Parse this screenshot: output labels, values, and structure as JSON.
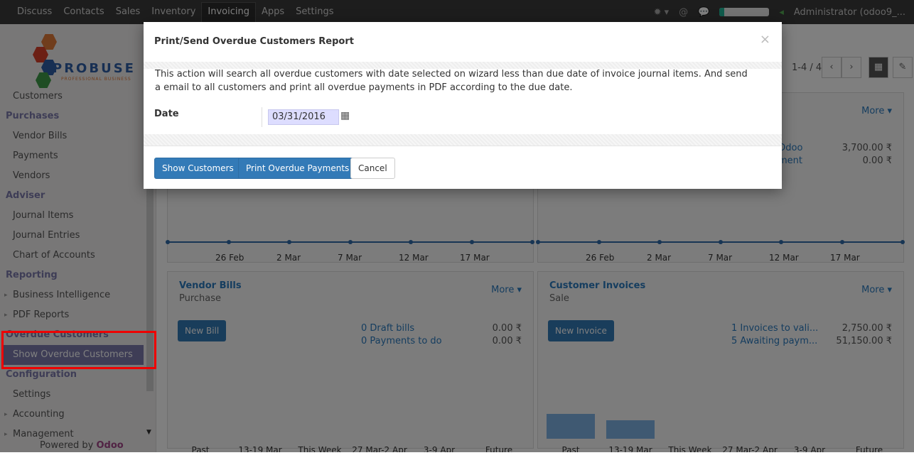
{
  "topbar": {
    "menu": [
      "Discuss",
      "Contacts",
      "Sales",
      "Inventory",
      "Invoicing",
      "Apps",
      "Settings"
    ],
    "active": "Invoicing",
    "user": "Administrator (odoo9_...",
    "progress": 0.1
  },
  "sidebar": {
    "logo_text": "PROBUSE",
    "logo_tag": "PROFESSIONAL BUSINESS",
    "items": [
      {
        "type": "link",
        "label": "Customers"
      },
      {
        "type": "section",
        "label": "Purchases"
      },
      {
        "type": "link",
        "label": "Vendor Bills"
      },
      {
        "type": "link",
        "label": "Payments"
      },
      {
        "type": "link",
        "label": "Vendors"
      },
      {
        "type": "section",
        "label": "Adviser"
      },
      {
        "type": "link",
        "label": "Journal Items"
      },
      {
        "type": "link",
        "label": "Journal Entries"
      },
      {
        "type": "link",
        "label": "Chart of Accounts"
      },
      {
        "type": "section",
        "label": "Reporting"
      },
      {
        "type": "caret",
        "label": "Business Intelligence"
      },
      {
        "type": "caret",
        "label": "PDF Reports"
      },
      {
        "type": "section",
        "label": "Overdue Customers"
      },
      {
        "type": "active",
        "label": "Show Overdue Customers"
      },
      {
        "type": "section",
        "label": "Configuration"
      },
      {
        "type": "link",
        "label": "Settings"
      },
      {
        "type": "caret",
        "label": "Accounting"
      },
      {
        "type": "caret",
        "label": "Management"
      }
    ],
    "powered_by": "Powered by",
    "powered_brand": "Odoo"
  },
  "main": {
    "pager": "1-4 / 4",
    "top_cards": {
      "more": "More ▾",
      "right_rows": [
        {
          "label": "Odoo",
          "value": "3,700.00 ₹"
        },
        {
          "label": "ment",
          "value": "0.00 ₹"
        }
      ],
      "graph_ticks": [
        "26 Feb",
        "2 Mar",
        "7 Mar",
        "12 Mar",
        "17 Mar"
      ]
    },
    "vendor_bills": {
      "title": "Vendor Bills",
      "sub": "Purchase",
      "more": "More ▾",
      "button": "New Bill",
      "rows": [
        {
          "label": "0 Draft bills",
          "value": "0.00 ₹"
        },
        {
          "label": "0 Payments to do",
          "value": "0.00 ₹"
        }
      ],
      "ticks": [
        "Past",
        "13-19 Mar",
        "This Week",
        "27 Mar-2 Apr",
        "3-9 Apr",
        "Future"
      ],
      "bars": [
        0,
        0,
        0,
        0,
        0,
        0
      ]
    },
    "customer_invoices": {
      "title": "Customer Invoices",
      "sub": "Sale",
      "more": "More ▾",
      "button": "New Invoice",
      "rows": [
        {
          "label": "1 Invoices to vali...",
          "value": "2,750.00 ₹"
        },
        {
          "label": "5 Awaiting paym...",
          "value": "51,150.00 ₹"
        }
      ],
      "ticks": [
        "Past",
        "13-19 Mar",
        "This Week",
        "27 Mar-2 Apr",
        "3-9 Apr",
        "Future"
      ],
      "bars": [
        35,
        26,
        0,
        0,
        0,
        0
      ]
    }
  },
  "modal": {
    "title": "Print/Send Overdue Customers Report",
    "close": "×",
    "description": "This action will search all overdue customers with date selected on wizard less than due date of invoice journal items. And send a email to all customers and print all overdue payments in PDF according to the due date.",
    "date_label": "Date",
    "date_value": "03/31/2016",
    "buttons": {
      "show": "Show Customers",
      "print": "Print Overdue Payments",
      "cancel": "Cancel"
    }
  }
}
